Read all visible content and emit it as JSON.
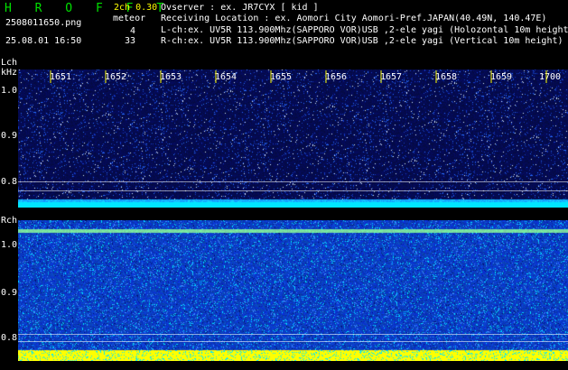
{
  "header": {
    "title": "H R O F F T",
    "version": "2ch 0.30",
    "filename": "2508011650.png",
    "datetime": "25.08.01 16:50",
    "meteor_label": "meteor",
    "meteor_count_l": "4",
    "meteor_count_r": "33",
    "observer_line": "Ovserver            : ex. JR7CYX [ kid ]",
    "location_line": "Receiving Location : ex. Aomori City Aomori-Pref.JAPAN(40.49N, 140.47E)",
    "lch_line": "L-ch:ex. UV5R 113.900Mhz(SAPPORO VOR)USB ,2-ele yagi (Holozontal 10m height)",
    "rch_line": "R-ch:ex. UV5R 113.900Mhz(SAPPORO VOR)USB ,2-ele yagi (Vertical 10m height)"
  },
  "lch": {
    "label": "Lch",
    "unit": "kHz",
    "yticks": [
      "1.0",
      "0.9",
      "0.8"
    ]
  },
  "rch": {
    "label": "Rch",
    "yticks": [
      "1.0",
      "0.9",
      "0.8"
    ]
  },
  "time_ticks": [
    "1651",
    "1652",
    "1653",
    "1654",
    "1655",
    "1656",
    "1657",
    "1658",
    "1659",
    "1700"
  ],
  "colors": {
    "background": "#000000",
    "title": "#00e000",
    "version": "#ffff00",
    "text": "#ffffff",
    "tick_marker": "#ffff00",
    "noise_low": "#0a1a8c",
    "noise_mid": "#1e5aff",
    "signal_cyan": "#00e5ff",
    "signal_yellow": "#ffff00"
  }
}
